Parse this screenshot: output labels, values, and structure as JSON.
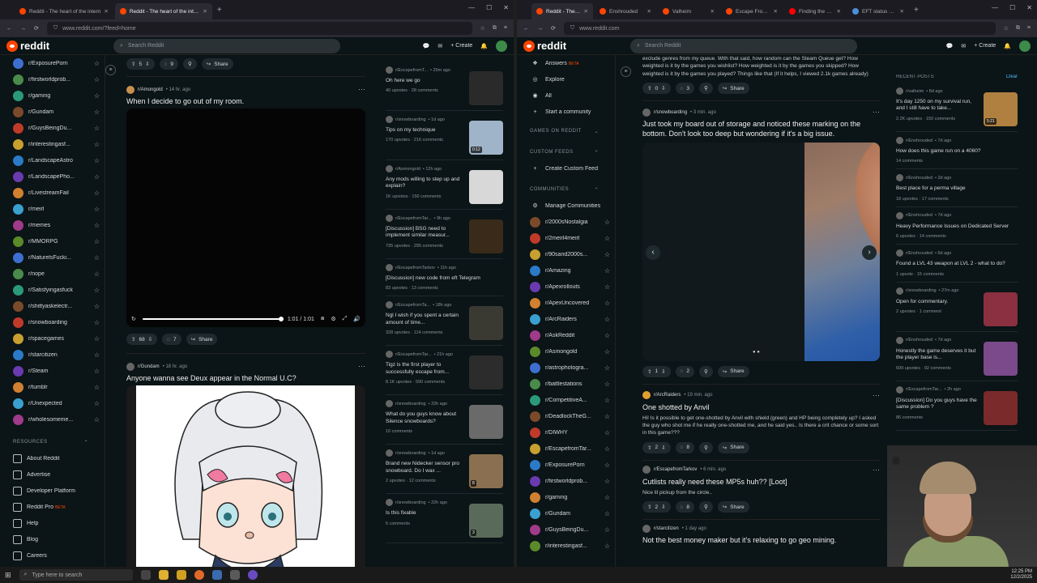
{
  "left": {
    "tabs": [
      {
        "title": "Reddit - The heart of the intern",
        "active": false
      },
      {
        "title": "Reddit - The heart of the intern",
        "active": true
      }
    ],
    "url": "www.reddit.com/?feed=home",
    "search_placeholder": "Search Reddit",
    "create_label": "Create",
    "sidebar": [
      "r/ExposurePorn",
      "r/firstworldprob...",
      "r/gaming",
      "r/Gundam",
      "r/GuysBeingDu...",
      "r/interestingasf...",
      "r/LandscapeAstro",
      "r/LandscapePho...",
      "r/LivestreamFail",
      "r/meirl",
      "r/memes",
      "r/MMORPG",
      "r/NaturelsFucki...",
      "r/nope",
      "r/Satisfyingasfuck",
      "r/shittyaskelectr...",
      "r/snowboarding",
      "r/spacegames",
      "r/starcitizen",
      "r/Steam",
      "r/tumblr",
      "r/Unexpected",
      "r/wholesomeme..."
    ],
    "resources_header": "RESOURCES",
    "resources": [
      "About Reddit",
      "Advertise",
      "Developer Platform",
      "Reddit Pro",
      "Help",
      "Blog",
      "Careers"
    ],
    "reddit_pro_badge": "BETA",
    "top_actions": {
      "votes": "5",
      "comments": "9",
      "share": "Share"
    },
    "post1": {
      "sub": "r/Amongold",
      "time": "• 14 hr. ago",
      "title": "When I decide to go out of my room.",
      "video_time": "1:01 / 1:01",
      "votes": "68",
      "comments": "7",
      "share": "Share"
    },
    "post2": {
      "sub": "r/Gundam",
      "time": "• 18 hr. ago",
      "title": "Anyone wanna see Deux appear in the Normal U.C?"
    },
    "feed": [
      {
        "sub": "r/EscapefromT...",
        "time": "• 29m ago",
        "title": "Oh here we go",
        "stats": "40 upvotes · 28 comments",
        "thumb": "#2a2a2a",
        "badge": ""
      },
      {
        "sub": "r/snowboarding",
        "time": "• 1d ago",
        "title": "Tips on my technique",
        "stats": "170 upvotes · 216 comments",
        "thumb": "#9fb4c8",
        "badge": "0:12"
      },
      {
        "sub": "r/Asmongold",
        "time": "• 12h ago",
        "title": "Any mods willing to step up and explain?",
        "stats": "1K upvotes · 150 comments",
        "thumb": "#d8d8d8",
        "badge": ""
      },
      {
        "sub": "r/EscapefromTar...",
        "time": "• 9h ago",
        "title": "[Discussion] BSG need to implement similar measur...",
        "stats": "735 upvotes · 295 comments",
        "thumb": "#3a2a1a",
        "badge": ""
      },
      {
        "sub": "r/EscapefromTarkov",
        "time": "• 11h ago",
        "title": "[Discussion] new code from eft Telegram",
        "stats": "83 upvotes · 13 comments",
        "thumb": "",
        "badge": ""
      },
      {
        "sub": "r/EscapefromTa...",
        "time": "• 18h ago",
        "title": "Ngl I wish if you spent a certain amount of time...",
        "stats": "328 upvotes · 114 comments",
        "thumb": "#3a3a32",
        "badge": ""
      },
      {
        "sub": "r/EscapefromTar...",
        "time": "• 21h ago",
        "title": "Tigz is the first player to successfully escape from...",
        "stats": "8.1K upvotes · 590 comments",
        "thumb": "#2c2c2c",
        "badge": ""
      },
      {
        "sub": "r/snowboarding",
        "time": "• 22h ago",
        "title": "What do you guys know about Silence snowboards?",
        "stats": "10 comments",
        "thumb": "#6a6a6a",
        "badge": ""
      },
      {
        "sub": "r/snowboarding",
        "time": "• 1d ago",
        "title": "Brand new Nidecker sensor pro snowboard. Do I wax ...",
        "stats": "2 upvotes · 12 comments",
        "thumb": "#8a7050",
        "badge": "8"
      },
      {
        "sub": "r/snowboarding",
        "time": "• 22h ago",
        "title": "Is this fixable",
        "stats": "6 comments",
        "thumb": "#5a6a5a",
        "badge": "3"
      }
    ]
  },
  "right": {
    "tabs": [
      {
        "title": "Reddit - The heart",
        "active": true,
        "color": "#ff4500"
      },
      {
        "title": "Enshrouded",
        "active": false,
        "color": "#ff4500"
      },
      {
        "title": "Valheim",
        "active": false,
        "color": "#ff4500"
      },
      {
        "title": "Escape From Tark",
        "active": false,
        "color": "#ff4500"
      },
      {
        "title": "Finding the World",
        "active": false,
        "color": "#ff0000"
      },
      {
        "title": "EFT status page",
        "active": false,
        "color": "#4a90d9"
      }
    ],
    "url": "www.reddit.com",
    "search_placeholder": "Search Reddit",
    "create_label": "Create",
    "nav": [
      {
        "label": "Answers",
        "badge": "BETA"
      },
      {
        "label": "Explore",
        "badge": ""
      },
      {
        "label": "All",
        "badge": ""
      },
      {
        "label": "Start a community",
        "badge": ""
      }
    ],
    "games_header": "GAMES ON REDDIT",
    "custom_feeds_header": "CUSTOM FEEDS",
    "create_custom_feed": "Create Custom Feed",
    "communities_header": "COMMUNITIES",
    "manage_communities": "Manage Communities",
    "communities": [
      "r/2000sNostalgia",
      "r/2meirl4meirl",
      "r/90sand2000s...",
      "r/Amazing",
      "r/Apexrollouts",
      "r/ApexUncovered",
      "r/ArcRaiders",
      "r/AskReddit",
      "r/Asmongold",
      "r/astrophotogra...",
      "r/battlestations",
      "r/CompetitiveA...",
      "r/DeadlockTheG...",
      "r/DIWHY",
      "r/EscapefromTar...",
      "r/ExposurePorn",
      "r/firstworldprob...",
      "r/gaming",
      "r/Gundam",
      "r/GuysBeingDu...",
      "r/interestingasf..."
    ],
    "top_body": "exclude genres from my queue. With that said, how random can the Steam Queue get? How weighted is it by the games you wishlist? How weighted is it by the games you skipped? How weighted is it by the games you played? Things like that (If it helps, I viewed 2.1k games already)",
    "top_actions": {
      "votes": "0",
      "comments": "3",
      "share": "Share"
    },
    "postA": {
      "sub": "r/snowboarding",
      "time": "• 3 min. ago",
      "title": "Just took my board out of storage and noticed these marking on the bottom. Don't look too deep but wondering if it's a big issue.",
      "votes": "1",
      "comments": "2",
      "share": "Share"
    },
    "postB": {
      "sub": "r/ArcRaiders",
      "time": "• 19 min. ago",
      "title": "One shotted by Anvil",
      "body": "Hi! Is it possible to get one-shotted by Anvil with shield (green) and HP being completely up? I asked the guy who shot me if he really one-shotted me, and he said yes.. Is there a crit chance or some sort in this game???",
      "votes": "2",
      "comments": "8",
      "share": "Share"
    },
    "postC": {
      "sub": "r/EscapefromTarkov",
      "time": "• 6 min. ago",
      "title": "Cutlists really need these MP5s huh?? [Loot]",
      "body": "Nice lil pickup from the circle..",
      "votes": "2",
      "comments": "8",
      "share": "Share"
    },
    "postD": {
      "sub": "r/starcitizen",
      "time": "• 1 day ago",
      "title": "Not the best money maker but it's relaxing to go geo mining."
    },
    "recent_header": "RECENT POSTS",
    "recent_clear": "Clear",
    "recent": [
      {
        "sub": "r/valheim",
        "time": "• 8d ago",
        "title": "It's day 1250 on my survival run, and I still have to take...",
        "stats": "2.2K upvotes · 150 comments",
        "thumb": "#b08040",
        "badge": "5:21"
      },
      {
        "sub": "r/Enshrouded",
        "time": "• 7d ago",
        "title": "How does this game run on a 4060?",
        "stats": "14 comments",
        "thumb": "",
        "badge": ""
      },
      {
        "sub": "r/Enshrouded",
        "time": "• 2d ago",
        "title": "Best place for a perma village",
        "stats": "18 upvotes · 17 comments",
        "thumb": "",
        "badge": ""
      },
      {
        "sub": "r/Enshrouded",
        "time": "• 7d ago",
        "title": "Heavy Performance Issues on Dedicated Server",
        "stats": "6 upvotes · 14 comments",
        "thumb": "",
        "badge": ""
      },
      {
        "sub": "r/Enshrouded",
        "time": "• 6d ago",
        "title": "Found a LVL 43 weapon at LVL 2 - what to do?",
        "stats": "1 upvote · 15 comments",
        "thumb": "",
        "badge": ""
      },
      {
        "sub": "r/snowboarding",
        "time": "• 27m ago",
        "title": "Open for commentary.",
        "stats": "2 upvotes · 1 comment",
        "thumb": "#8a3040",
        "badge": ""
      },
      {
        "sub": "r/Enshrouded",
        "time": "• 7d ago",
        "title": "Honestly the game deserves it but the player base is...",
        "stats": "699 upvotes · 92 comments",
        "thumb": "#7a4a8a",
        "badge": ""
      },
      {
        "sub": "r/EscapefromTar...",
        "time": "• 2h ago",
        "title": "[Discussion] Do you guys have the same problem ?",
        "stats": "86 comments",
        "thumb": "#7a2a2a",
        "badge": ""
      }
    ]
  },
  "taskbar": {
    "search": "Type here to search",
    "time": "12:25 PM",
    "date": "12/2/2025"
  }
}
